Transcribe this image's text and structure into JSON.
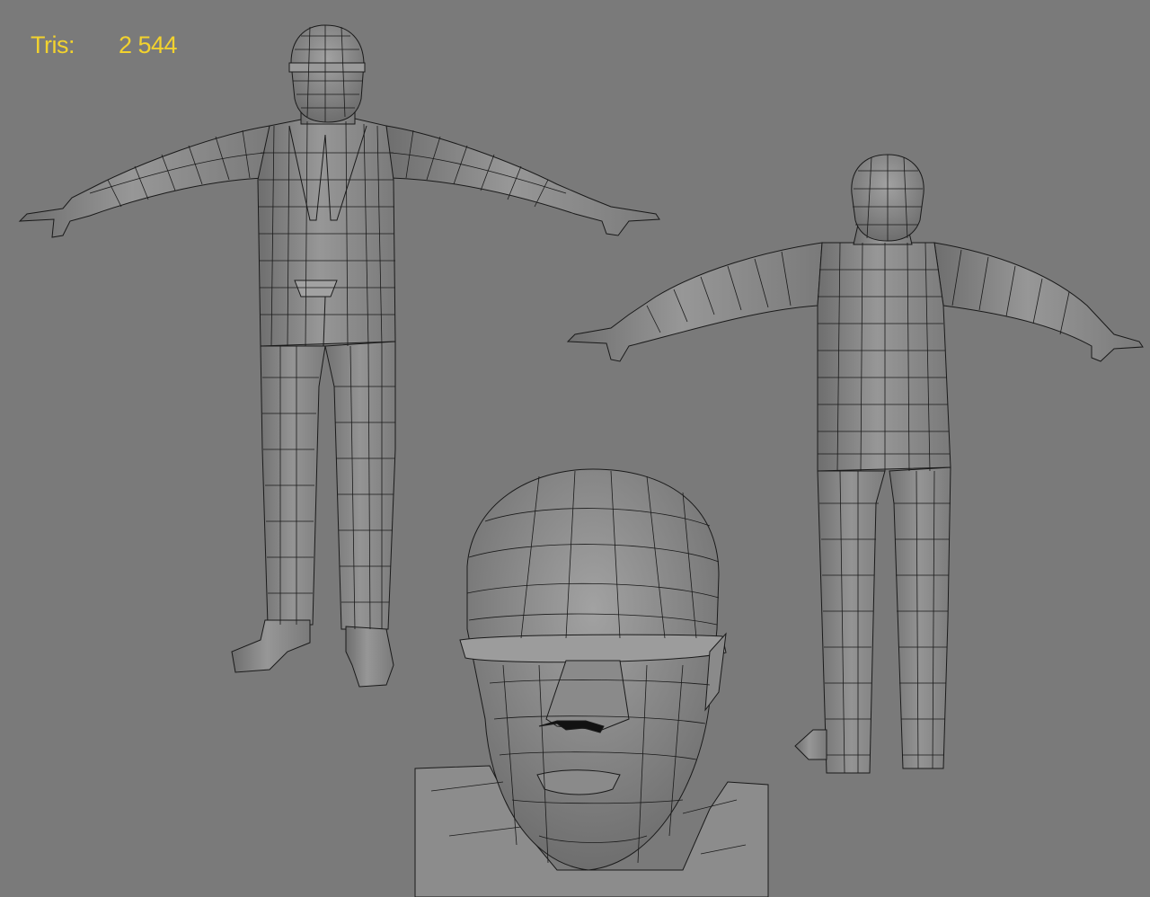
{
  "viewport": {
    "background": "#7a7a7a",
    "mesh_fill": "#8a8a8a",
    "wire_color": "#1a1a1a",
    "stats": {
      "label": "Tris:",
      "value": "2 544",
      "color": "#f2d22e"
    },
    "views": [
      {
        "name": "front-view",
        "subject": "character-front"
      },
      {
        "name": "back-view",
        "subject": "character-back"
      },
      {
        "name": "head-closeup-view",
        "subject": "head-closeup"
      }
    ]
  }
}
